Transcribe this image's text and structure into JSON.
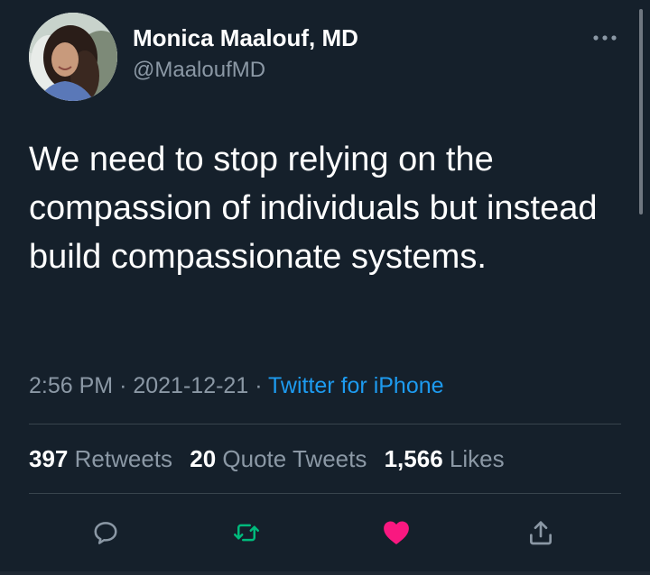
{
  "author": {
    "display_name": "Monica Maalouf, MD",
    "handle": "@MaaloufMD"
  },
  "tweet": {
    "text": "We need to stop relying on the compassion of individuals but instead build compassionate systems."
  },
  "meta": {
    "time": "2:56 PM",
    "separator": "·",
    "date": "2021-12-21",
    "source": "Twitter for iPhone"
  },
  "stats": {
    "retweets": {
      "count": "397",
      "label": "Retweets"
    },
    "quotes": {
      "count": "20",
      "label": "Quote Tweets"
    },
    "likes": {
      "count": "1,566",
      "label": "Likes"
    }
  },
  "actions": {
    "reply_icon": "reply-icon",
    "retweet_icon": "retweet-icon",
    "like_icon": "heart-icon",
    "share_icon": "share-icon"
  },
  "colors": {
    "background": "#15202b",
    "secondary_text": "#8b98a5",
    "link": "#1d9bf0",
    "retweet": "#00ba7c",
    "like": "#f91880",
    "divider": "#38444d"
  }
}
